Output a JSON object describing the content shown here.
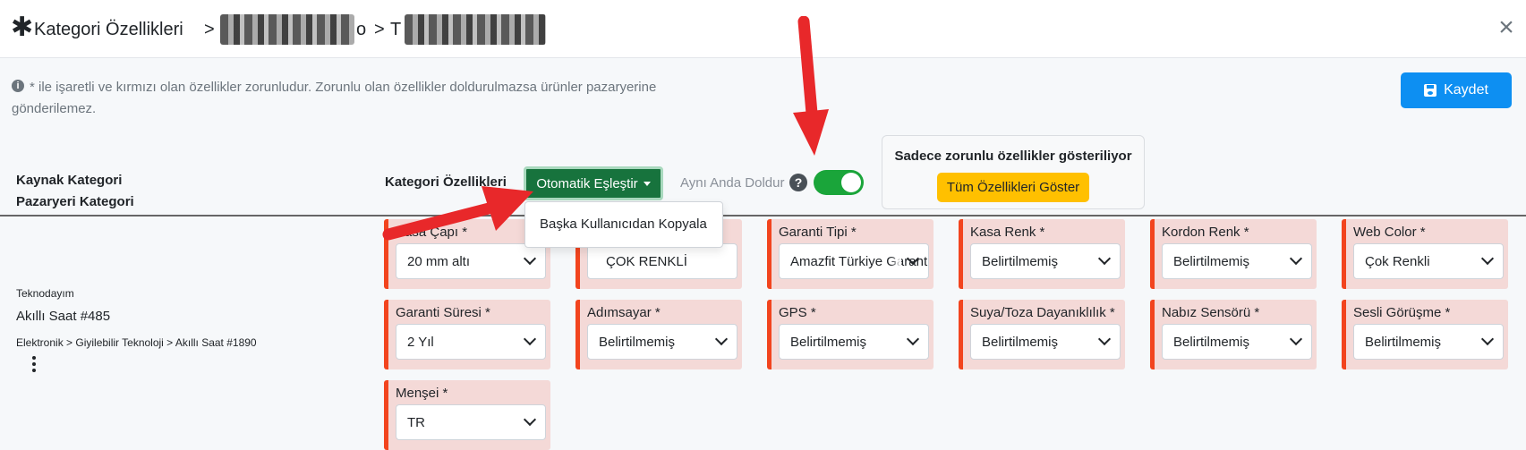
{
  "header": {
    "star": "✱",
    "title": "Kategori Özellikleri",
    "sep1": ">",
    "crumb1_tail": "o",
    "sep2": ">",
    "crumb2_head": "T",
    "close": "×"
  },
  "info": {
    "icon": "i",
    "text": "* ile işaretli ve kırmızı olan özellikler zorunludur. Zorunlu olan özellikler doldurulmazsa ürünler pazaryerine gönderilemez."
  },
  "save_button": {
    "label": "Kaydet"
  },
  "left_panel": {
    "source_heading": "Kaynak Kategori",
    "market_heading": "Pazaryeri Kategori",
    "brand": "Teknodayım",
    "category_name": "Akıllı Saat #485",
    "category_path": "Elektronik > Giyilebilir Teknoloji > Akıllı Saat #1890"
  },
  "controls": {
    "category_features_label": "Kategori Özellikleri",
    "auto_match_label": "Otomatik Eşleştir",
    "dropdown_item": "Başka Kullanıcıdan Kopyala",
    "simultaneous_label": "Aynı Anda Doldur",
    "help_icon": "?",
    "toggle_on": true
  },
  "required_box": {
    "title": "Sadece zorunlu özellikler gösteriliyor",
    "show_all_label": "Tüm Özellikleri Göster"
  },
  "attributes": [
    {
      "label": "Kasa Çapı *",
      "value": "20 mm altı"
    },
    {
      "label": "",
      "value": "ÇOK RENKLİ"
    },
    {
      "label": "Garanti Tipi *",
      "value": "Amazfit Türkiye Garantili"
    },
    {
      "label": "Kasa Renk *",
      "value": "Belirtilmemiş"
    },
    {
      "label": "Kordon Renk *",
      "value": "Belirtilmemiş"
    },
    {
      "label": "Web Color *",
      "value": "Çok Renkli"
    },
    {
      "label": "Garanti Süresi *",
      "value": "2 Yıl"
    },
    {
      "label": "Adımsayar *",
      "value": "Belirtilmemiş"
    },
    {
      "label": "GPS *",
      "value": "Belirtilmemiş"
    },
    {
      "label": "Suya/Toza Dayanıklılık *",
      "value": "Belirtilmemiş"
    },
    {
      "label": "Nabız Sensörü *",
      "value": "Belirtilmemiş"
    },
    {
      "label": "Sesli Görüşme *",
      "value": "Belirtilmemiş"
    },
    {
      "label": "Menşei *",
      "value": "TR"
    }
  ],
  "colors": {
    "primary": "#0d8ff2",
    "success": "#17733d",
    "warning": "#ffc000",
    "required_border": "#f2441e",
    "required_bg": "#f4d9d7",
    "annotation_arrow": "#e8282a"
  }
}
